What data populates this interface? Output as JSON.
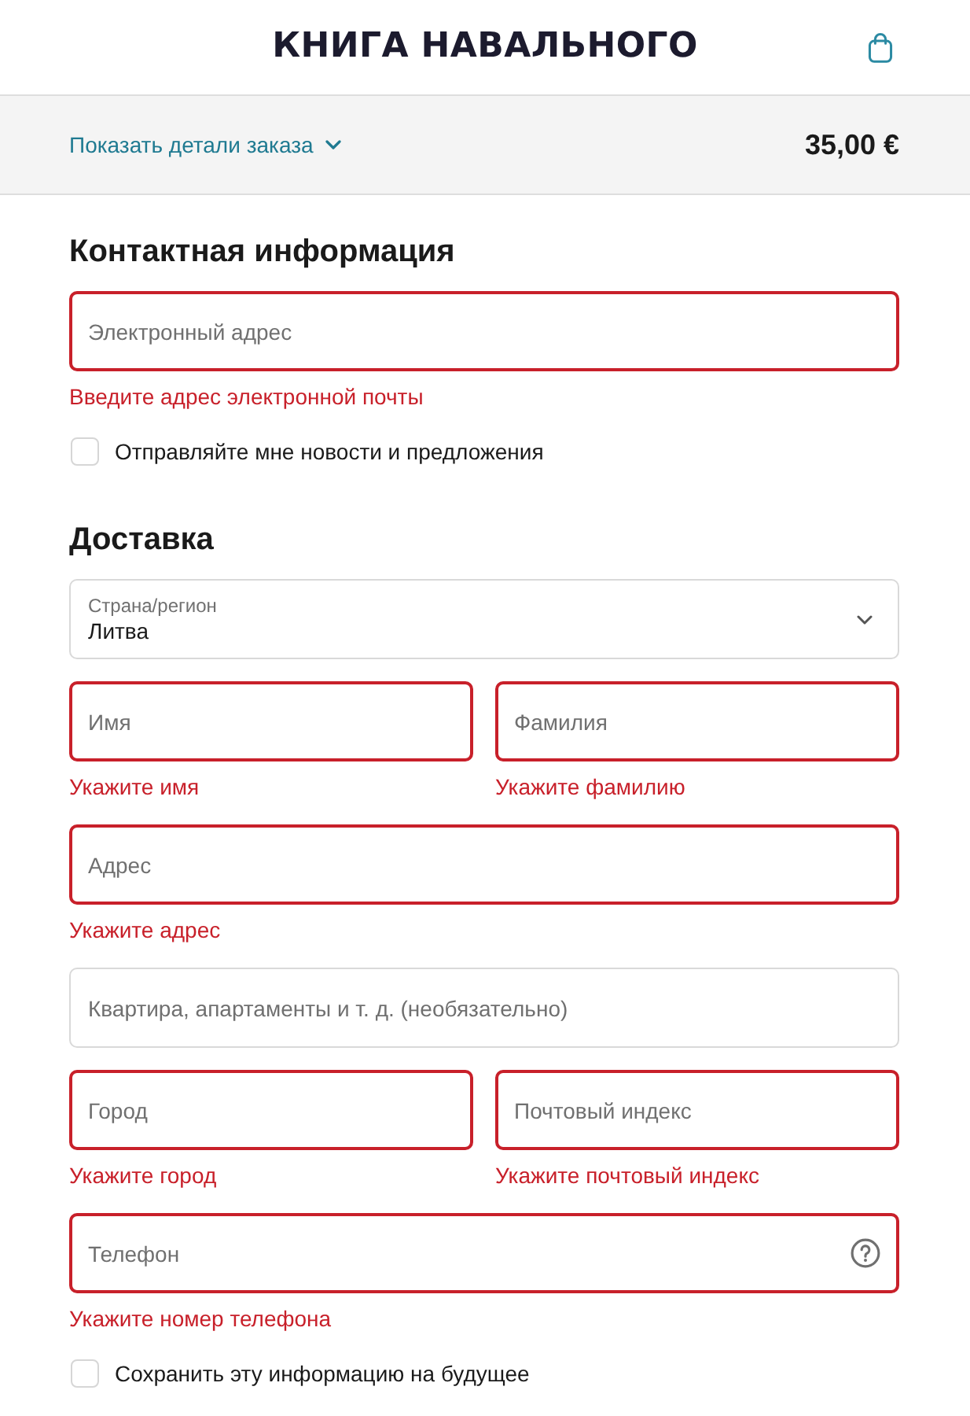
{
  "header": {
    "title": "КНИГА НАВАЛЬНОГО"
  },
  "order_summary": {
    "toggle_label": "Показать детали заказа",
    "expanded": false,
    "total": "35,00 €"
  },
  "sections": [
    {
      "heading": "Контактная информация",
      "items": [
        {
          "kind": "fields",
          "fields": [
            {
              "kind": "text",
              "placeholder": "Электронный адрес",
              "error": "Введите адрес электронной почты"
            }
          ]
        },
        {
          "kind": "checkbox",
          "label": "Отправляйте мне новости и предложения",
          "checked": false
        }
      ]
    },
    {
      "heading": "Доставка",
      "items": [
        {
          "kind": "fields",
          "fields": [
            {
              "kind": "select",
              "label": "Страна/регион",
              "value": "Литва"
            }
          ]
        },
        {
          "kind": "fields",
          "fields": [
            {
              "kind": "text",
              "placeholder": "Имя",
              "error": "Укажите имя"
            },
            {
              "kind": "text",
              "placeholder": "Фамилия",
              "error": "Укажите фамилию"
            }
          ]
        },
        {
          "kind": "fields",
          "fields": [
            {
              "kind": "text",
              "placeholder": "Адрес",
              "error": "Укажите адрес"
            }
          ]
        },
        {
          "kind": "fields",
          "fields": [
            {
              "kind": "text",
              "placeholder": "Квартира, апартаменты и т. д. (необязательно)"
            }
          ]
        },
        {
          "kind": "fields",
          "fields": [
            {
              "kind": "text",
              "placeholder": "Город",
              "error": "Укажите город"
            },
            {
              "kind": "text",
              "placeholder": "Почтовый индекс",
              "error": "Укажите почтовый индекс"
            }
          ]
        },
        {
          "kind": "fields",
          "fields": [
            {
              "kind": "text",
              "placeholder": "Телефон",
              "error": "Укажите номер телефона",
              "help": true
            }
          ]
        },
        {
          "kind": "checkbox",
          "label": "Сохранить эту информацию на будущее",
          "checked": false
        }
      ]
    }
  ]
}
